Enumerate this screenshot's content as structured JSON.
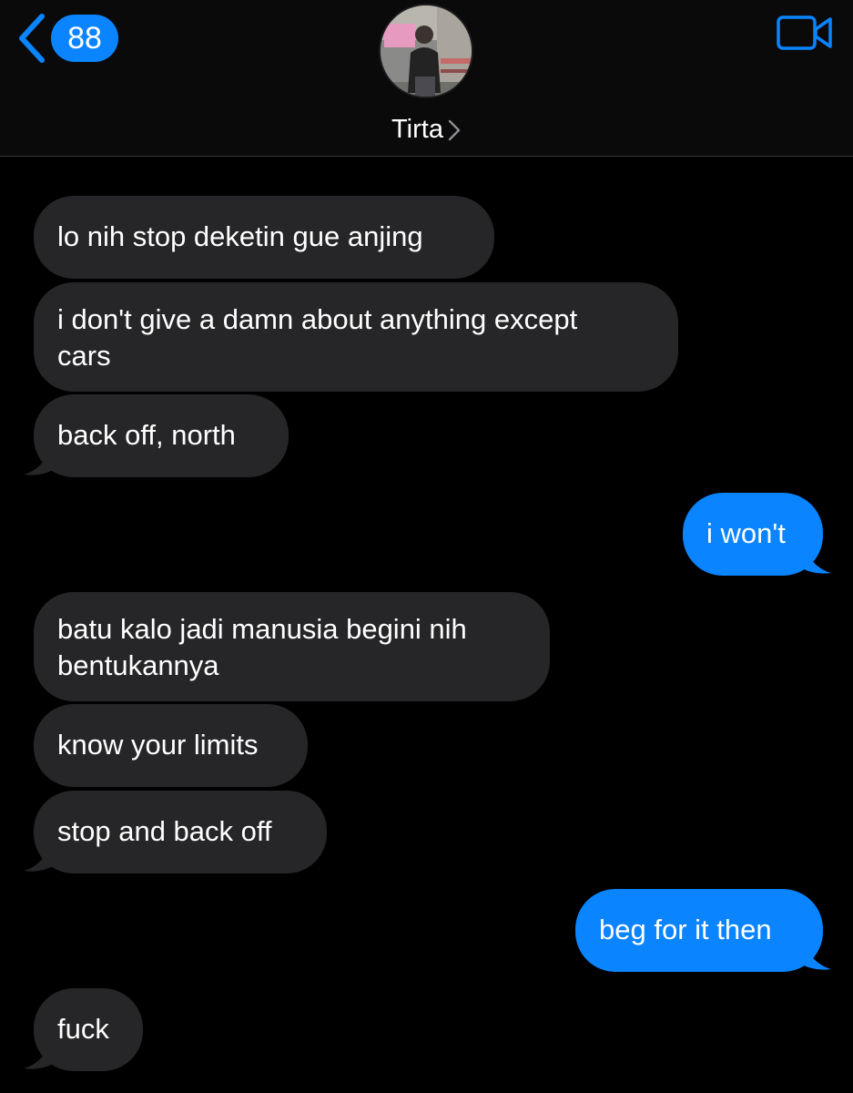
{
  "header": {
    "back_badge": "88",
    "contact_name": "Tirta",
    "accent_color": "#0a84ff"
  },
  "messages": [
    {
      "from": "contact",
      "text": "lo nih stop deketin gue anjing"
    },
    {
      "from": "contact",
      "text": "i don't give a damn about anything except\ncars"
    },
    {
      "from": "contact",
      "text": "back off, north"
    },
    {
      "from": "me",
      "text": "i won't"
    },
    {
      "from": "contact",
      "text": "batu kalo jadi manusia begini nih\nbentukannya"
    },
    {
      "from": "contact",
      "text": "know your limits"
    },
    {
      "from": "contact",
      "text": "stop and back off"
    },
    {
      "from": "me",
      "text": "beg for it then"
    },
    {
      "from": "contact",
      "text": "fuck"
    }
  ],
  "colors": {
    "received_bubble": "#262628",
    "sent_bubble": "#0a84ff",
    "background": "#000000"
  }
}
